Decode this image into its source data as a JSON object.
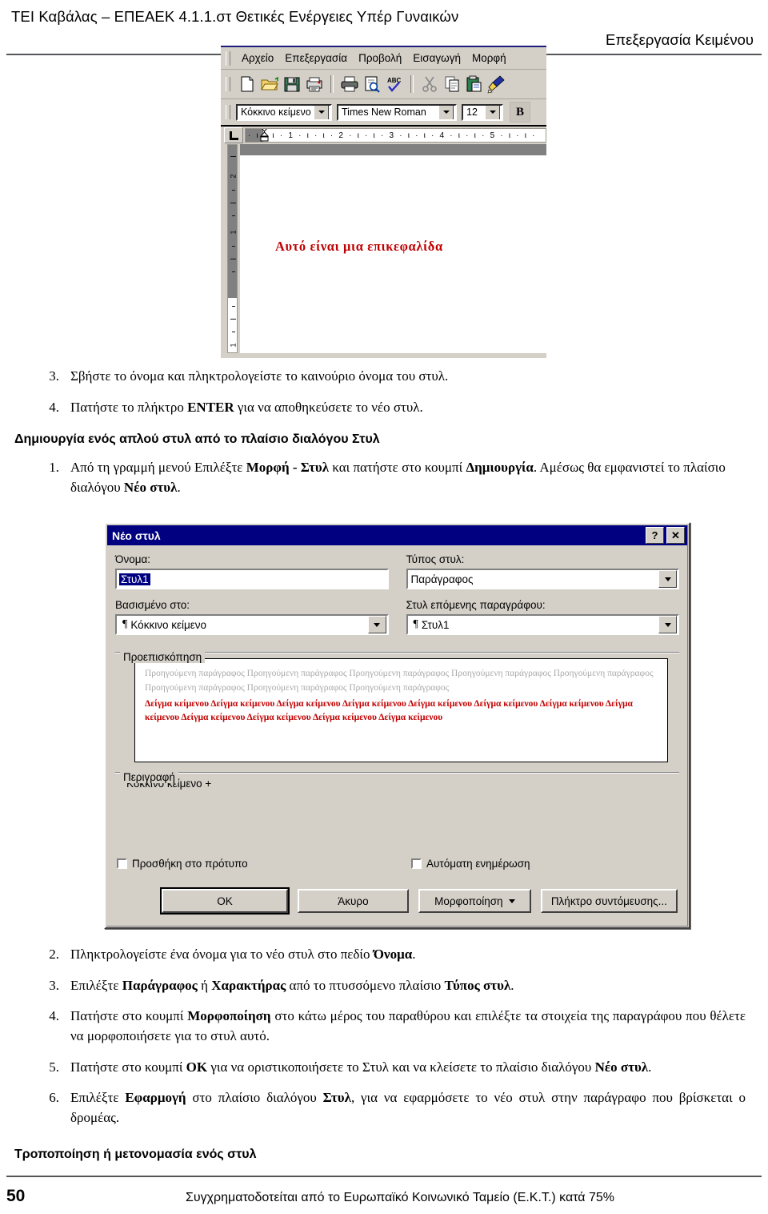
{
  "header": {
    "line1": "ΤΕΙ Καβάλας – ΕΠΕΑΕΚ 4.1.1.στ Θετικές Ενέργειες Υπέρ Γυναικών",
    "line2": "Επεξεργασία Κειμένου"
  },
  "word_window": {
    "menu": [
      {
        "label": "Αρχείο",
        "accel": "Α"
      },
      {
        "label": "Επεξεργασία",
        "accel": "Ε"
      },
      {
        "label": "Προβολή",
        "accel": "ρ"
      },
      {
        "label": "Εισαγωγή",
        "accel": "ω"
      },
      {
        "label": "Μορφή",
        "accel": "Μ"
      }
    ],
    "toolbar_icons": [
      "new-document-icon",
      "open-folder-icon",
      "save-disk-icon",
      "print-setup-icon",
      "print-icon",
      "print-preview-icon",
      "spellcheck-icon",
      "cut-scissors-icon",
      "copy-icon",
      "paste-clipboard-icon",
      "format-painter-icon"
    ],
    "style_box": "Κόκκινο κείμενο",
    "font_box": "Times New Roman",
    "size_box": "12",
    "bold_button": "B",
    "h_ruler_ticks": "· ι · ι · 1 · ι · ι · 2 · ι · ι · 3 · ι · ι · 4 · ι · ι · 5 · ι · ι ·",
    "v_ruler_labels": [
      "2",
      "1",
      "1"
    ],
    "document_heading": "Αυτό είναι μια επικεφαλίδα",
    "heading_color": "#c00000"
  },
  "list_a": [
    {
      "num": "3.",
      "text": "Σβήστε το όνομα και πληκτρολογείστε το καινούριο όνομα του στυλ."
    },
    {
      "num": "4.",
      "pre": "Πατήστε το πλήκτρο ",
      "bold": "ENTER",
      "post": " για να αποθηκεύσετε το νέο στυλ."
    }
  ],
  "section_heading_1": "Δημιουργία ενός απλού στυλ από το πλαίσιο διαλόγου Στυλ",
  "list_b": [
    {
      "num": "1.",
      "p1": "Από τη γραμμή μενού Επιλέξτε ",
      "b1": "Μορφή - Στυλ",
      "p2": " και πατήστε στο κουμπί ",
      "b2": "Δημιουργία",
      "p3": ". Αμέσως θα εμφανιστεί το πλαίσιο διαλόγου ",
      "b3": "Νέο στυλ",
      "p4": "."
    }
  ],
  "dialog": {
    "title": "Νέο στυλ",
    "help_button": "?",
    "close_button": "✕",
    "name_label": "Όνομα:",
    "name_label_accel": "ο",
    "name_value": "Στυλ1",
    "type_label": "Τύπος στυλ:",
    "type_label_accel": "Τ",
    "type_value": "Παράγραφος",
    "basedon_label": "Βασισμένο στο:",
    "basedon_label_accel": "σ",
    "basedon_value": "Κόκκινο κείμενο",
    "nextstyle_label": "Στυλ επόμενης παραγράφου:",
    "nextstyle_label_accel": "υ",
    "nextstyle_value": "Στυλ1",
    "pilcrow": "¶",
    "preview_legend": "Προεπισκόπηση",
    "preview_gray": "Προηγούμενη παράγραφος Προηγούμενη παράγραφος Προηγούμενη παράγραφος Προηγούμενη παράγραφος Προηγούμενη παράγραφος Προηγούμενη παράγραφος Προηγούμενη παράγραφος Προηγούμενη παράγραφος",
    "preview_red": "Δείγμα κείμενου Δείγμα κείμενου Δείγμα κείμενου Δείγμα κείμενου Δείγμα κείμενου Δείγμα κείμενου Δείγμα κείμενου Δείγμα κείμενου Δείγμα κείμενου Δείγμα κείμενου Δείγμα κείμενου Δείγμα κείμενου",
    "preview_red_color": "#c00000",
    "desc_legend": "Περιγραφή",
    "desc_text": "Κόκκινο κείμενο +",
    "chk_template": "Προσθήκη στο πρότυπο",
    "chk_template_accel": "θ",
    "chk_autoupdate": "Αυτόματη ενημέρωση",
    "chk_autoupdate_accel": "ό",
    "btn_ok": "OK",
    "btn_cancel": "Άκυρο",
    "btn_format": "Μορφοποίηση",
    "btn_format_accel": "π",
    "btn_shortcut": "Πλήκτρο συντόμευσης...",
    "btn_shortcut_accel": "λ",
    "titlebar_color": "#000080"
  },
  "list_c": [
    {
      "num": "2.",
      "p1": "Πληκτρολογείστε ένα όνομα για το νέο στυλ στο πεδίο ",
      "b1": "Όνομα",
      "p2": "."
    },
    {
      "num": "3.",
      "p1": "Επιλέξτε ",
      "b1": "Παράγραφος",
      "p2": " ή ",
      "b2": "Χαρακτήρας",
      "p3": " από το πτυσσόμενο πλαίσιο ",
      "b3": "Τύπος στυλ",
      "p4": "."
    },
    {
      "num": "4.",
      "p1": "Πατήστε στο κουμπί ",
      "b1": "Μορφοποίηση",
      "p2": " στο κάτω μέρος του παραθύρου και επιλέξτε τα στοιχεία της παραγράφου που θέλετε να μορφοποιήσετε για το στυλ αυτό."
    },
    {
      "num": "5.",
      "p1": "Πατήστε στο κουμπί ",
      "b1": "OK",
      "p2": " για να οριστικοποιήσετε το Στυλ και να κλείσετε το πλαίσιο διαλόγου ",
      "b3": "Νέο στυλ",
      "p4": "."
    },
    {
      "num": "6.",
      "p1": "Επιλέξτε ",
      "b1": "Εφαρμογή",
      "p2": " στο πλαίσιο διαλόγου ",
      "b2": "Στυλ",
      "p3": ", για να εφαρμόσετε το νέο στυλ στην παράγραφο που βρίσκεται ο δρομέας."
    }
  ],
  "section_heading_2": "Τροποποίηση ή μετονομασία ενός στυλ",
  "footer": {
    "page_number": "50",
    "text": "Συγχρηματοδοτείται από το Ευρωπαϊκό Κοινωνικό Ταμείο (Ε.Κ.Τ.) κατά 75%"
  }
}
